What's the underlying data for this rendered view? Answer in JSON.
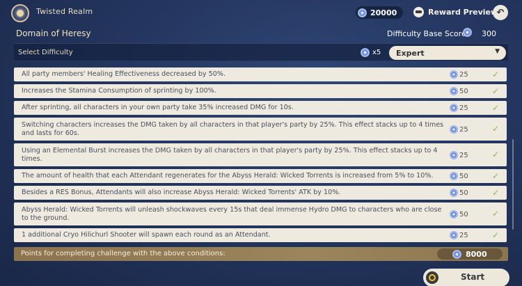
{
  "header": {
    "realm_title": "Twisted Realm",
    "currency_value": "20000",
    "reward_preview_label": "Reward Preview",
    "back_icon": "back-arrow-icon"
  },
  "domain": {
    "name": "Domain of Heresy",
    "base_score_label": "Difficulty Base Score",
    "base_score_value": "300"
  },
  "difficulty": {
    "label": "Select Difficulty",
    "multiplier": "x5",
    "selected": "Expert"
  },
  "conditions": [
    {
      "text": "All party members' Healing Effectiveness decreased by 50%.",
      "points": "25",
      "checked": true
    },
    {
      "text": "Increases the Stamina Consumption of sprinting by 100%.",
      "points": "50",
      "checked": true
    },
    {
      "text": "After sprinting, all characters in your own party take 35% increased DMG for 10s.",
      "points": "25",
      "checked": true
    },
    {
      "text": "Switching characters increases the DMG taken by all characters in that player's party by 25%. This effect stacks up to 4 times and lasts for 60s.",
      "points": "25",
      "checked": true
    },
    {
      "text": "Using an Elemental Burst increases the DMG taken by all characters in that player's party by 25%. This effect stacks up to 4 times.",
      "points": "25",
      "checked": true
    },
    {
      "text": "The amount of health that each Attendant regenerates for the Abyss Herald: Wicked Torrents is increased from 5% to 10%.",
      "points": "50",
      "checked": true
    },
    {
      "text": "Besides a RES Bonus, Attendants will also increase Abyss Herald: Wicked Torrents' ATK by 10%.",
      "points": "50",
      "checked": true
    },
    {
      "text": "Abyss Herald: Wicked Torrents will unleash shockwaves every 15s that deal immense Hydro DMG to characters who are close to the ground.",
      "points": "50",
      "checked": true
    },
    {
      "text": "1 additional Cryo Hilichurl Shooter will spawn each round as an Attendant.",
      "points": "25",
      "checked": true
    }
  ],
  "summary": {
    "label": "Points for completing challenge with the above conditions:",
    "total": "8000"
  },
  "start": {
    "label": "Start"
  },
  "colors": {
    "background": "#24365f",
    "row_bg": "#efeadf",
    "check": "#7fbf3a",
    "points_bar": "#9c845c",
    "accent_gold": "#f2c236"
  }
}
